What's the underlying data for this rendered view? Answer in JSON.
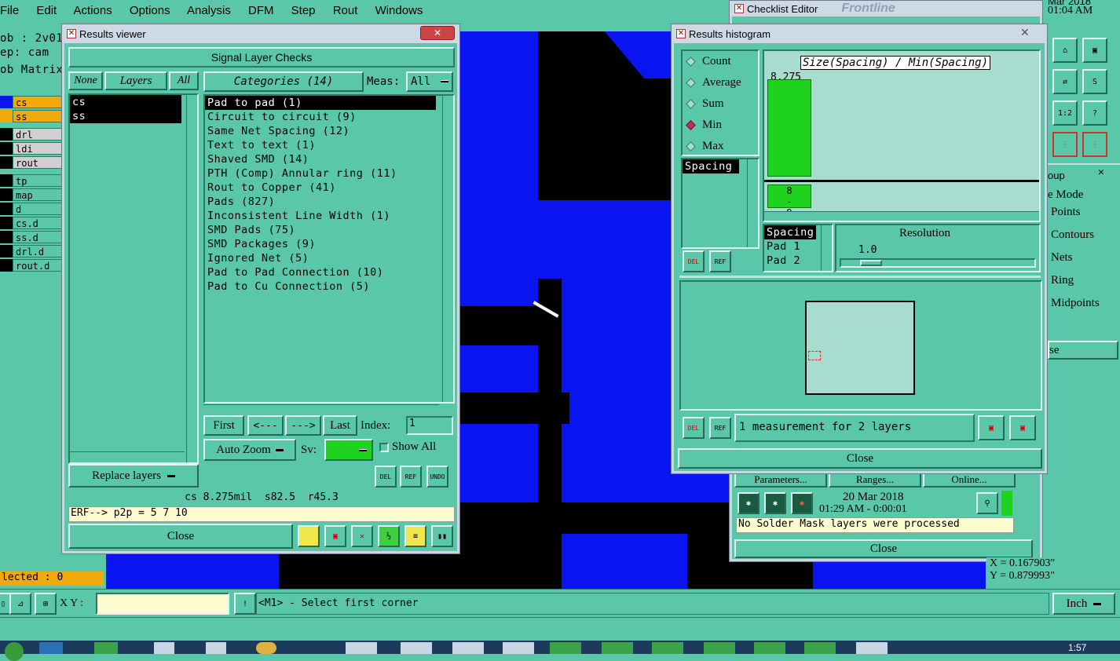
{
  "menubar": {
    "items": [
      "File",
      "Edit",
      "Actions",
      "Options",
      "Analysis",
      "DFM",
      "Step",
      "Rout",
      "Windows"
    ]
  },
  "left_panel": {
    "job_label": "ob : 2v01",
    "step_label": "ep: cam",
    "matrix_label": "ob Matrix",
    "layers": [
      "cs",
      "ss",
      "drl",
      "ldi",
      "rout",
      "tp",
      "map",
      "d",
      "cs.d",
      "ss.d",
      "drl.d",
      "rout.d"
    ],
    "selected_label": "lected : 0"
  },
  "results_viewer": {
    "title": "Results viewer",
    "header": "Signal Layer Checks",
    "none_btn": "None",
    "layers_label": "Layers",
    "all_btn": "All",
    "layer_list": [
      "cs",
      "ss"
    ],
    "categories_label": "Categories (14)",
    "meas_label": "Meas:",
    "meas_value": "All",
    "categories": [
      "Pad to pad (1)",
      "Circuit to circuit (9)",
      "Same Net Spacing (12)",
      "Text to text (1)",
      "Shaved SMD (14)",
      "PTH (Comp) Annular ring (11)",
      "Rout to Copper (41)",
      "Pads (827)",
      "Inconsistent Line Width (1)",
      "SMD Pads (75)",
      "SMD Packages (9)",
      "Ignored Net (5)",
      "Pad to Pad Connection (10)",
      "Pad to Cu Connection (5)"
    ],
    "first_btn": "First",
    "prev_btn": "<---",
    "next_btn": "--->",
    "last_btn": "Last",
    "index_label": "Index:",
    "index_value": "1",
    "auto_zoom": "Auto Zoom",
    "sv_label": "Sv:",
    "show_all": "Show All",
    "replace_layers": "Replace layers",
    "del": "DEL",
    "ref": "REF",
    "undo": "UNDO",
    "status_line": "cs 8.275mil  s82.5  r45.3",
    "erf_line": "ERF--> p2p = 5 7 10",
    "close": "Close"
  },
  "histogram": {
    "title": "Results histogram",
    "options": [
      "Count",
      "Average",
      "Sum",
      "Min",
      "Max"
    ],
    "selected_option": "Min",
    "spacing_item": "Spacing",
    "chart_title": "Size(Spacing) / Min(Spacing)",
    "bar_value_label": "8.275",
    "bar_bin_label": "8-9",
    "attr_list": [
      "Spacing",
      "Pad 1",
      "Pad 2"
    ],
    "resolution_label": "Resolution",
    "resolution_value": "1.0",
    "measurement_text": "1 measurement for 2 layers",
    "del": "DEL",
    "ref": "REF",
    "close": "Close"
  },
  "checklist": {
    "title": "Checklist Editor",
    "brand_text": "Frontline",
    "parameters_btn": "Parameters...",
    "ranges_btn": "Ranges...",
    "online_btn": "Online...",
    "date": "20 Mar 2018",
    "time": "01:29 AM - 0:00:01",
    "message": "No Solder Mask layers were processed",
    "close": "Close"
  },
  "right_panel": {
    "date_clip": "Mar 2018",
    "time_clip": "01:04 AM",
    "group_label": "oup",
    "mode_label": "e Mode",
    "items": [
      "Points",
      "Contours",
      "Nets",
      "Ring",
      "Midpoints"
    ],
    "close_clip": "se",
    "x_coord": "X = 0.167903\"",
    "y_coord": "Y = 0.879993\""
  },
  "statusbar": {
    "xy_label": "X Y :",
    "xy_value": "",
    "prompt": "<M1> - Select first corner",
    "unit": "Inch"
  },
  "taskbar": {
    "clock": "1:57"
  },
  "colors": {
    "panel": "#5ac8a8",
    "canvas_blue": "#0a14f0",
    "canvas_black": "#000000",
    "bar_green": "#1ed21e",
    "highlight_yellow": "#f2a90b"
  }
}
